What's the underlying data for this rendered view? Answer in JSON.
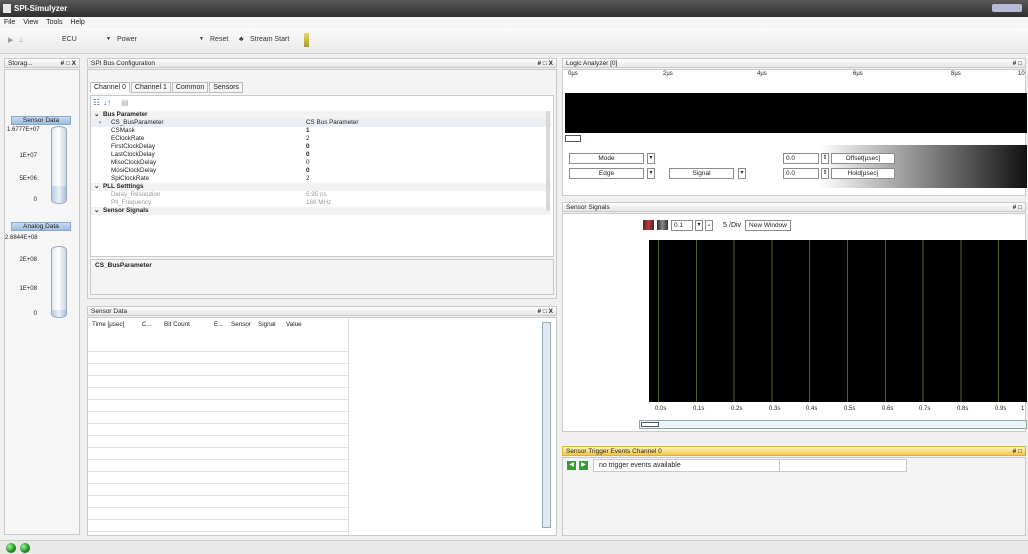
{
  "window": {
    "title": "SPI-Simulyzer"
  },
  "menu": [
    "File",
    "View",
    "Tools",
    "Help"
  ],
  "toolbar": {
    "ecu": "ECU",
    "power": "Power",
    "reset": "Reset",
    "stream_start": "Stream Start"
  },
  "storage": {
    "title": "Storag...",
    "sensor_label": "Sensor Data",
    "sensor_value": "1.6777E+07",
    "sensor_ticks": [
      "1E+07",
      "5E+06",
      "0"
    ],
    "analog_label": "Analog Data",
    "analog_value": "2.6844E+08",
    "analog_ticks": [
      "2E+08",
      "1E+08",
      "0"
    ]
  },
  "spi_config": {
    "title": "SPI Bus Configuration",
    "tabs": [
      "Channel 0",
      "Channel 1",
      "Common",
      "Sensors"
    ],
    "categories": {
      "bus": "Bus Parameter",
      "pll": "PLL Setttings",
      "sensor": "Sensor Signals"
    },
    "rows": [
      {
        "name": "CS_BusParameter",
        "value": "CS Bus Parameter"
      },
      {
        "name": "CSMask",
        "value": "1"
      },
      {
        "name": "EClockRate",
        "value": "2"
      },
      {
        "name": "FirstClockDelay",
        "value": "0"
      },
      {
        "name": "LastClockDelay",
        "value": "0"
      },
      {
        "name": "MisoClockDelay",
        "value": "0"
      },
      {
        "name": "MosiClockDelay",
        "value": "0"
      },
      {
        "name": "SpiClockRate",
        "value": "2"
      }
    ],
    "pll_rows": [
      {
        "name": "Delay_Resolution",
        "value": "5.95 ns"
      },
      {
        "name": "Pll_Frequency",
        "value": "168 MHz"
      }
    ],
    "description": "CS_BusParameter"
  },
  "sensor_data": {
    "title": "Sensor Data",
    "columns": [
      "Time [µsec]",
      "C...",
      "Bit Count",
      "E...",
      "Sensor",
      "Signal",
      "Value"
    ]
  },
  "logic": {
    "title": "Logic Analyzer [0]",
    "axis": [
      "0µs",
      "2µs",
      "4µs",
      "6µs",
      "8µs",
      "10"
    ],
    "mode_label": "Mode",
    "edge_label": "Edge",
    "signal_label": "Signal",
    "offset_value": "0.0",
    "hold_value": "0.0",
    "offset_label": "Offset[µsec]",
    "hold_label": "Hold[µsec]"
  },
  "sensor_signals": {
    "title": "Sensor Signals",
    "zoom": "0.1",
    "div_value": "5",
    "div_unit": "/Div",
    "new_window": "New Window",
    "axis": [
      "0.0s",
      "0.1s",
      "0.2s",
      "0.3s",
      "0.4s",
      "0.5s",
      "0.6s",
      "0.7s",
      "0.8s",
      "0.9s",
      "1"
    ]
  },
  "trigger": {
    "title": "Sensor Trigger Events Channel 0",
    "message": "no trigger events available"
  },
  "panel_controls": "# □ X",
  "panel_pin": "# □"
}
